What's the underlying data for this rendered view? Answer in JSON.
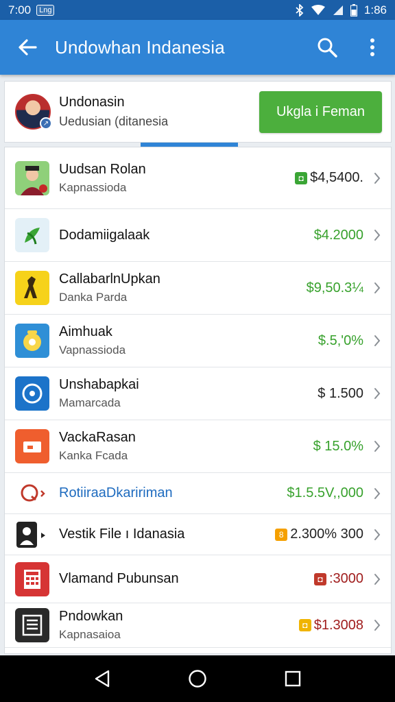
{
  "status_bar": {
    "time": "7:00",
    "badge": "Lng",
    "right_text": "1:86",
    "icons": [
      "bluetooth-icon",
      "wifi-icon",
      "signal-icon",
      "battery-icon"
    ]
  },
  "app_bar": {
    "title": "Undowhan Indanesia",
    "icons": [
      "back-arrow-icon",
      "search-icon",
      "more-vert-icon"
    ]
  },
  "account": {
    "name": "Undonasin",
    "subtitle": "Uedusian (ditanesia",
    "button_label": "Ukgla i Feman"
  },
  "items": [
    {
      "title": "Uudsan Rolan",
      "subtitle": "Kapnassioda",
      "amount": "$4,5400.",
      "amount_color": "#222222",
      "badge": "◘",
      "badge_color": "#3aa535",
      "icon": "person-photo-icon",
      "icon_bg": "#8fd07a"
    },
    {
      "title": "Dodamiigalaak",
      "subtitle": "",
      "amount": "$4.2000",
      "amount_color": "#37a12c",
      "badge": "",
      "badge_color": "",
      "icon": "leaf-logo-icon",
      "icon_bg": "#e3f0f7"
    },
    {
      "title": "CallabarlnUpkan",
      "subtitle": "Danka Parda",
      "amount": "$9,50.3¼",
      "amount_color": "#37a12c",
      "badge": "",
      "badge_color": "",
      "icon": "figure-icon",
      "icon_bg": "#f6d21a"
    },
    {
      "title": "Aimhuak",
      "subtitle": "Vapnassioda",
      "amount": "$.5,'0%",
      "amount_color": "#37a12c",
      "badge": "",
      "badge_color": "",
      "icon": "alarm-clock-icon",
      "icon_bg": "#2f8fd6"
    },
    {
      "title": "Unshabapkai",
      "subtitle": "Mamarcada",
      "amount": "$ 1.500",
      "amount_color": "#222222",
      "badge": "",
      "badge_color": "",
      "icon": "compass-icon",
      "icon_bg": "#1c73c9"
    },
    {
      "title": "VackaRasan",
      "subtitle": "Kanka Fcada",
      "amount": "$ 15.0%",
      "amount_color": "#37a12c",
      "badge": "",
      "badge_color": "",
      "icon": "wallet-icon",
      "icon_bg": "#ef5e2e"
    },
    {
      "title": "RotiiraaDkaririman",
      "subtitle": "",
      "amount": "$1.5.5V,,000",
      "amount_color": "#37a12c",
      "badge": "",
      "badge_color": "",
      "icon": "chat-bubble-icon",
      "icon_bg": "#ffffff",
      "title_color": "#1e6bbf"
    },
    {
      "title": "Vestik File ı Idanasia",
      "subtitle": "",
      "amount": "2.300% 300",
      "amount_color": "#222222",
      "badge": "8",
      "badge_color": "#f5a000",
      "icon": "contact-icon",
      "icon_bg": "#222222"
    },
    {
      "title": "Vlamand Pubunsan",
      "subtitle": "",
      "amount": ":3000",
      "amount_color": "#a01d1d",
      "badge": "◘",
      "badge_color": "#c0392b",
      "icon": "calculator-icon",
      "icon_bg": "#d63434"
    },
    {
      "title": "Pndowkan",
      "subtitle": "Kapnasaioa",
      "amount": "$1.3008",
      "amount_color": "#a01d1d",
      "badge": "◘",
      "badge_color": "#f0b400",
      "icon": "document-icon",
      "icon_bg": "#2a2a2a"
    }
  ],
  "nav_bar": {
    "icons": [
      "nav-back-icon",
      "nav-home-icon",
      "nav-recents-icon"
    ]
  }
}
